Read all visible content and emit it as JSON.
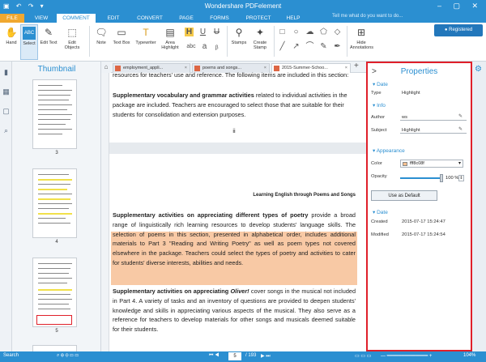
{
  "window": {
    "title": "Wondershare PDFelement",
    "registered": "Registered"
  },
  "menu": {
    "tabs": [
      "FILE",
      "VIEW",
      "COMMENT",
      "EDIT",
      "CONVERT",
      "PAGE",
      "FORMS",
      "PROTECT",
      "HELP"
    ],
    "active": "COMMENT",
    "tell_me": "Tell me what do you want to do..."
  },
  "ribbon": {
    "hand": "Hand",
    "select": "Select",
    "edit_text": "Edit Text",
    "edit_objects": "Edit Objects",
    "note": "Note",
    "text_box": "Text Box",
    "typewriter": "Typewriter",
    "area_highlight": "Area Highlight",
    "stamps": "Stamps",
    "create_stamp": "Create Stamp",
    "hide_annotations": "Hide Annotations"
  },
  "thumbnail": {
    "title": "Thumbnail",
    "pages": [
      "3",
      "4",
      "5"
    ]
  },
  "doc_tabs": [
    {
      "label": "employment_appli...",
      "active": false
    },
    {
      "label": "poems and songs...",
      "active": false
    },
    {
      "label": "2015-Summer-Schoo...",
      "active": true
    }
  ],
  "document": {
    "top_cut": "resources for teachers' use and reference. The following items are included in this section:",
    "p1_bold": "Supplementary vocabulary and grammar activities",
    "p1_rest": " related to individual activities in the package are included. Teachers are encouraged to select those that are suitable for their students for consolidation and extension purposes.",
    "page_num": "ii",
    "header": "Learning English through Poems and Songs",
    "p2_bold": "Supplementary activities on appreciating different types of poetry",
    "p2_rest": " provide a broad range of linguistically rich learning resources to develop students' language skills. The selection of poems in this section, presented in alphabetical order, includes additional materials to Part 3 \"Reading and Writing Poetry\" as well as poem types not covered elsewhere in the package. Teachers could select the types of poetry and activities to cater for students' diverse interests, abilities and needs.",
    "p3_bold": "Supplementary activities on appreciating ",
    "p3_italic": "Oliver!",
    "p3_rest": " cover songs in the musical not included in Part 4. A variety of tasks and an inventory of questions are provided to deepen students' knowledge and skills in appreciating various aspects of the musical. They also serve as a reference for teachers to develop materials for other songs and musicals deemed suitable for their students."
  },
  "properties": {
    "title": "Properties",
    "date_section": "Date",
    "type_label": "Type",
    "type_value": "Highlight",
    "info_section": "Info",
    "author_label": "Author",
    "author_value": "ws",
    "subject_label": "Subject",
    "subject_value": "Highlight",
    "appearance_section": "Appearance",
    "color_label": "Color",
    "color_value": "fff8c08f",
    "color_hex": "#f8c08f",
    "opacity_label": "Opacity",
    "opacity_value": "100",
    "opacity_unit": "%",
    "opacity_level": 1.0,
    "use_default": "Use as Default",
    "date2_section": "Date",
    "created_label": "Created",
    "created_value": "2015-07-17 15:24:47",
    "modified_label": "Modified",
    "modified_value": "2015-07-17 15:24:54"
  },
  "status": {
    "search": "Search",
    "current_page": "5",
    "total_pages": "/ 193",
    "zoom": "104%"
  },
  "colors": {
    "accent": "#2b8fd1",
    "highlight": "#f8c9a5",
    "panel_border": "#e0202a"
  }
}
